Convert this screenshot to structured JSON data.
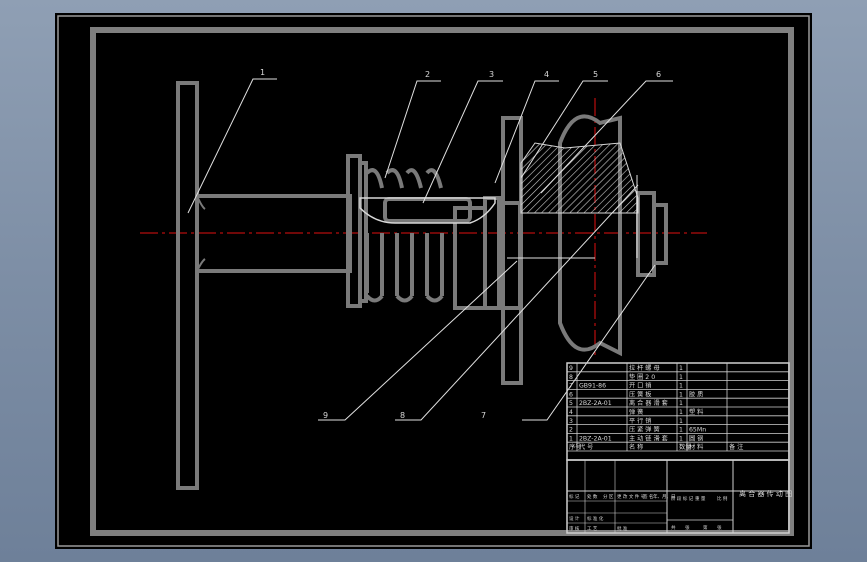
{
  "drawing": {
    "balloons": [
      "1",
      "2",
      "3",
      "4",
      "5",
      "6",
      "7",
      "8",
      "9"
    ],
    "bom": [
      {
        "no": "9",
        "code": "",
        "name": "拉 杆 螺 母",
        "qty": "1",
        "material": "",
        "note": ""
      },
      {
        "no": "8",
        "code": "",
        "name": "垫 圈 2 0",
        "qty": "1",
        "material": "",
        "note": ""
      },
      {
        "no": "7",
        "code": "GB91-86",
        "name": "开 口 销",
        "qty": "1",
        "material": "",
        "note": ""
      },
      {
        "no": "6",
        "code": "",
        "name": "压 簧 板",
        "qty": "1",
        "material": "胶 质",
        "note": ""
      },
      {
        "no": "5",
        "code": "2BZ-2A-01",
        "name": "离 合 器 滑 套",
        "qty": "1",
        "material": "",
        "note": ""
      },
      {
        "no": "4",
        "code": "",
        "name": "弹 簧",
        "qty": "1",
        "material": "塑 料",
        "note": ""
      },
      {
        "no": "3",
        "code": "",
        "name": "平 行 销",
        "qty": "1",
        "material": "",
        "note": ""
      },
      {
        "no": "2",
        "code": "",
        "name": "压 紧 弹 簧",
        "qty": "1",
        "material": "65Mn",
        "note": ""
      },
      {
        "no": "1",
        "code": "2BZ-2A-01",
        "name": "主 动 链 滑 套",
        "qty": "1",
        "material": "圆 钢",
        "note": ""
      }
    ],
    "bom_header": {
      "no": "序号",
      "code": "代 号",
      "name": "名 称",
      "qty": "数量",
      "material": "材 料",
      "note": "备 注"
    },
    "title_block": {
      "drawing_title": "离 合 器 传 动 图",
      "cells": [
        "标 记",
        "处 数",
        "分 区",
        "更 改 文 件 号",
        "签 名",
        "年、月、日",
        "设 计",
        "标 准 化",
        "阶 段 标 记",
        "重 量",
        "比 例",
        "审 核",
        "工 艺",
        "批 准",
        "共",
        "张",
        "第",
        "张"
      ]
    }
  },
  "colors": {
    "background": "#000000",
    "line": "#d8d8d8",
    "centerline": "#e01010",
    "hatch": "#cfcfcf"
  }
}
